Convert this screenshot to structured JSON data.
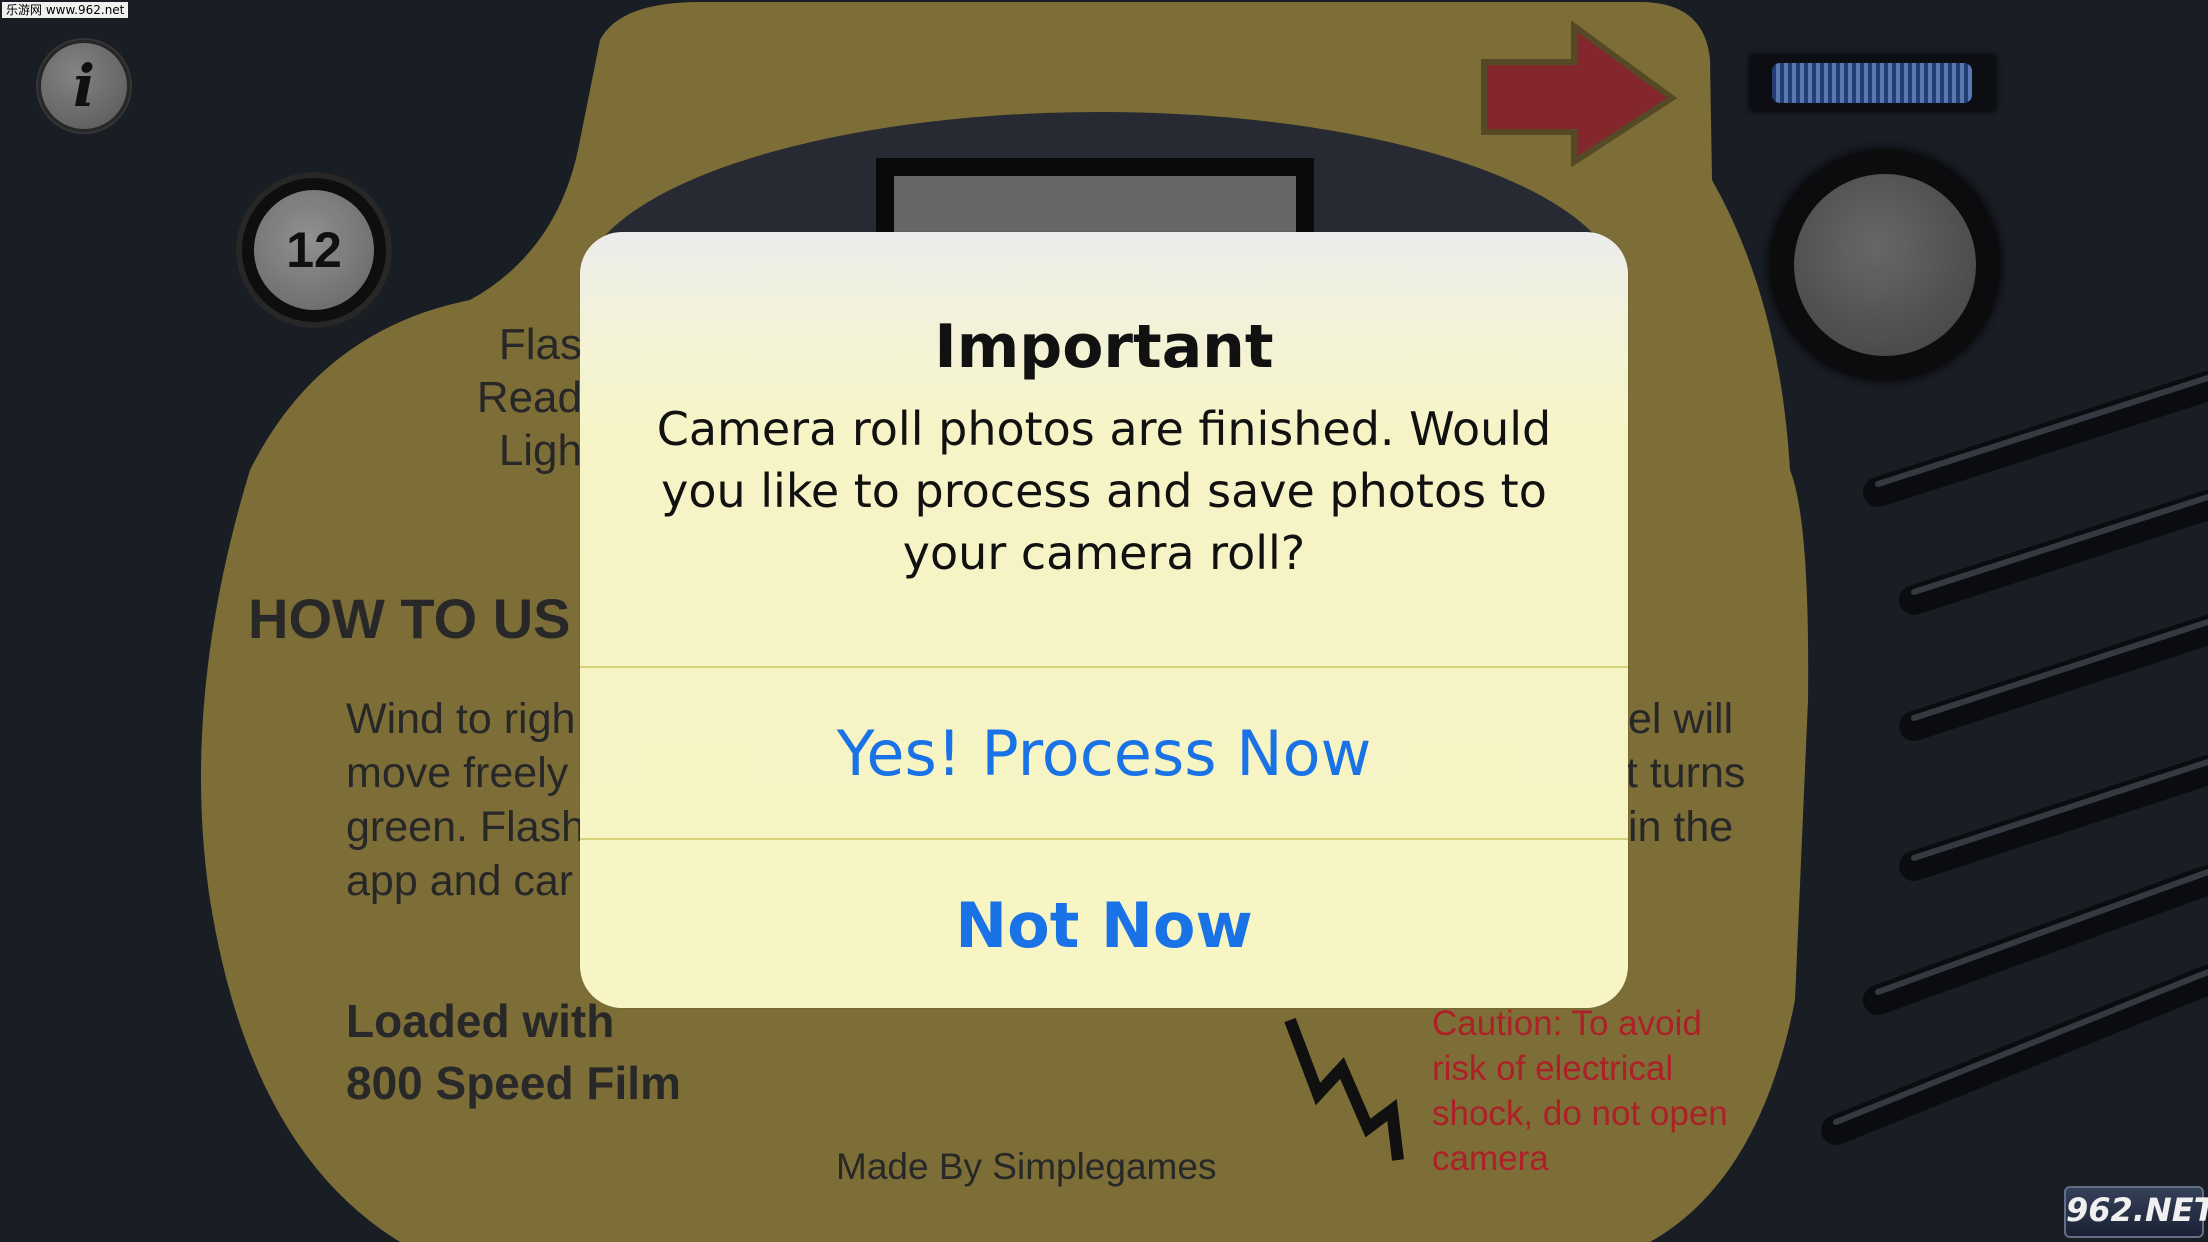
{
  "watermark_top": "乐游网 www.962.net",
  "watermark_bottom": "962.NET",
  "info_button": "i",
  "shot_counter": "12",
  "background_text": {
    "flash_lines": [
      "Flas",
      "Read",
      "Ligh"
    ],
    "how_to": "HOW TO US",
    "wind_lines": [
      "Wind to righ",
      "move freely",
      "green. Flash",
      "app and car"
    ],
    "right_lines": [
      "el will",
      "nt turns",
      "in the"
    ],
    "loaded": [
      "Loaded with",
      "800 Speed Film"
    ],
    "made_by": "Made By Simplegames",
    "caution": "Caution: To avoid risk of electrical shock, do not open camera"
  },
  "dialog": {
    "title": "Important",
    "message": "Camera roll photos are finished. Would you like to process and save photos to your camera roll?",
    "primary_button": "Yes! Process Now",
    "secondary_button": "Not Now"
  },
  "colors": {
    "camera_body": "#85753c",
    "background": "#1b1f27",
    "arrow": "#8c2a30",
    "button_text": "#1a73e6",
    "caution_text": "#b8232a"
  }
}
